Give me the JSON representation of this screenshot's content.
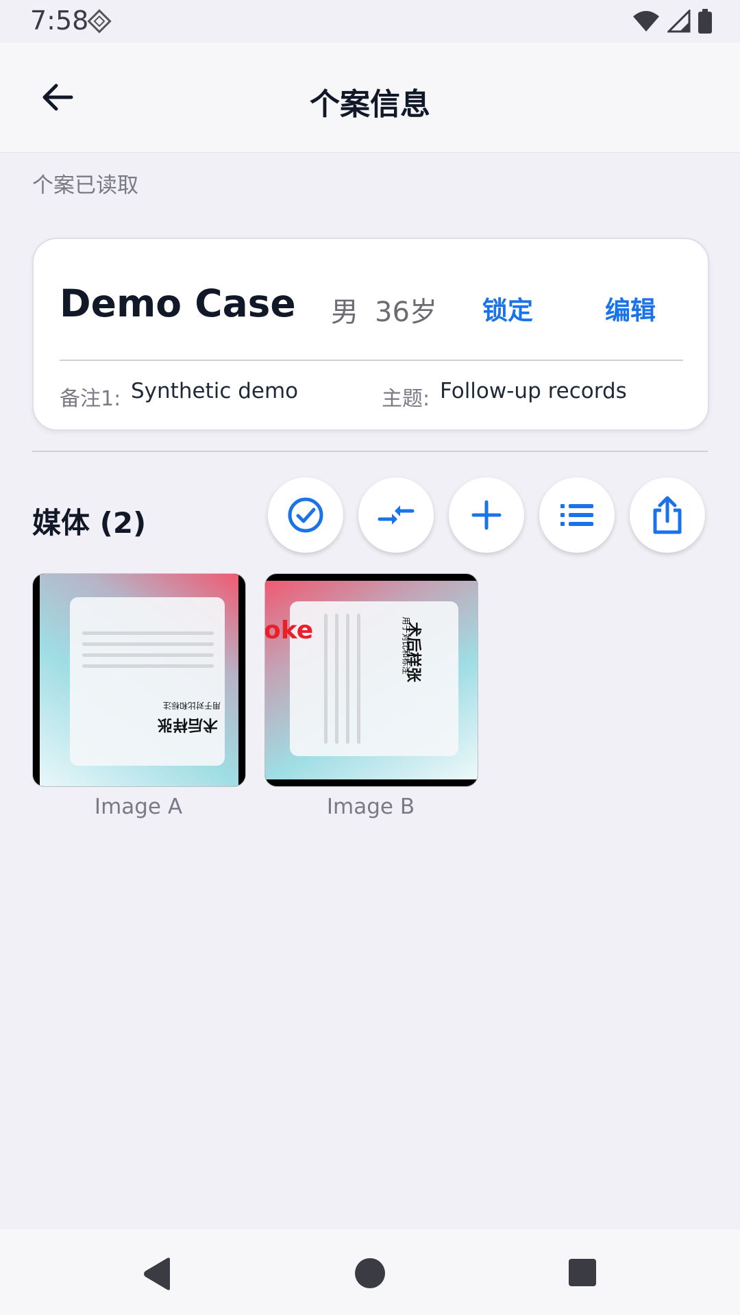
{
  "status_bar": {
    "time": "7:58"
  },
  "app_bar": {
    "title": "个案信息"
  },
  "status_note": "个案已读取",
  "case": {
    "name": "Demo Case",
    "sex": "男",
    "age": "36岁",
    "lock_label": "锁定",
    "edit_label": "编辑",
    "note_label": "备注1:",
    "note_value": "Synthetic demo",
    "topic_label": "主题:",
    "topic_value": "Follow-up records"
  },
  "media": {
    "title": "媒体 (2)",
    "actions": [
      "select-all",
      "compare",
      "add",
      "list",
      "share"
    ],
    "items": [
      {
        "caption": "Image A",
        "overlay_title": "术后样张",
        "overlay_sub": "用于对比和标注"
      },
      {
        "caption": "Image B",
        "overlay_title": "术后样张",
        "overlay_sub": "用于对比和标注",
        "red_text": "oke"
      }
    ]
  },
  "colors": {
    "accent": "#1a73e8",
    "background": "#f1f0f6"
  }
}
